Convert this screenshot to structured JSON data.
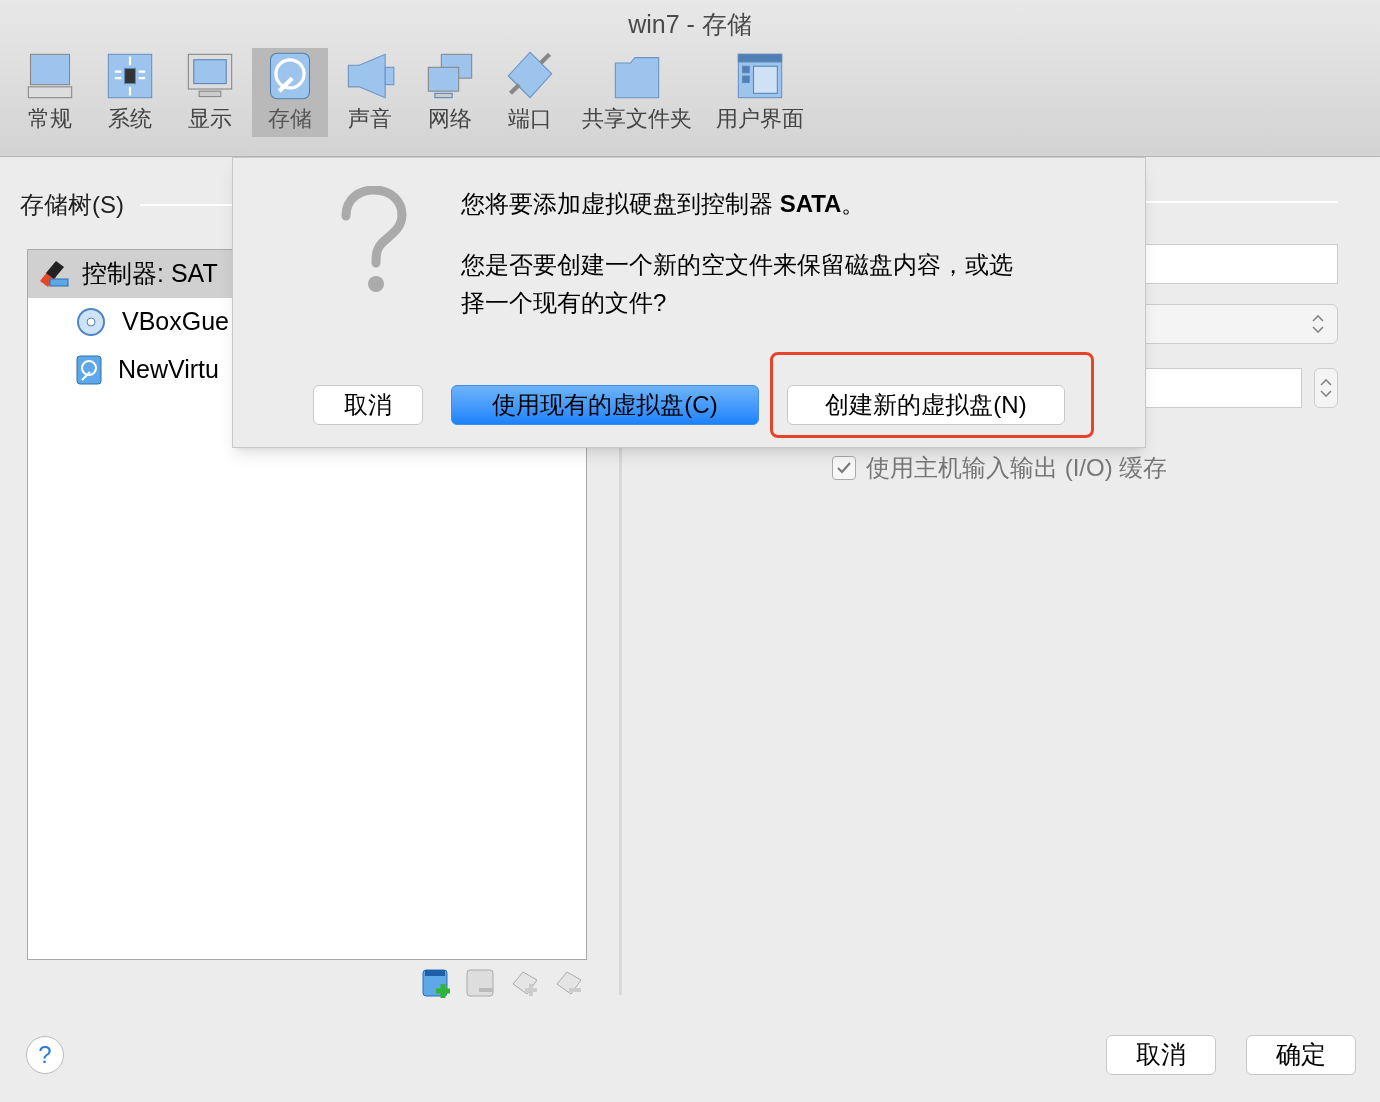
{
  "window": {
    "title": "win7 - 存储"
  },
  "toolbar": [
    {
      "label": "常规",
      "selected": false
    },
    {
      "label": "系统",
      "selected": false
    },
    {
      "label": "显示",
      "selected": false
    },
    {
      "label": "存储",
      "selected": true
    },
    {
      "label": "声音",
      "selected": false
    },
    {
      "label": "网络",
      "selected": false
    },
    {
      "label": "端口",
      "selected": false
    },
    {
      "label": "共享文件夹",
      "selected": false
    },
    {
      "label": "用户界面",
      "selected": false
    }
  ],
  "storage_tree": {
    "heading": "存储树(S)",
    "items": [
      {
        "label": "控制器: SAT",
        "selected": true,
        "children": [
          {
            "label": "VBoxGue",
            "kind": "optical",
            "selected": false
          },
          {
            "label": "NewVirtu",
            "kind": "disk",
            "selected": false
          }
        ]
      }
    ]
  },
  "properties": {
    "io_cache": {
      "label": "使用主机输入输出 (I/O) 缓存",
      "checked": true
    }
  },
  "dialog": {
    "title": "您将要添加虚拟硬盘到控制器 **SATA**。",
    "message": "您是否要创建一个新的空文件来保留磁盘内容，或选择一个现有的文件?",
    "buttons": [
      {
        "label": "取消",
        "kind": "plain"
      },
      {
        "label": "使用现有的虚拟盘(C)",
        "kind": "default"
      },
      {
        "label": "创建新的虚拟盘(N)",
        "kind": "highlighted"
      }
    ]
  },
  "footer": {
    "help": "?",
    "buttons": [
      "取消",
      "确定"
    ]
  }
}
